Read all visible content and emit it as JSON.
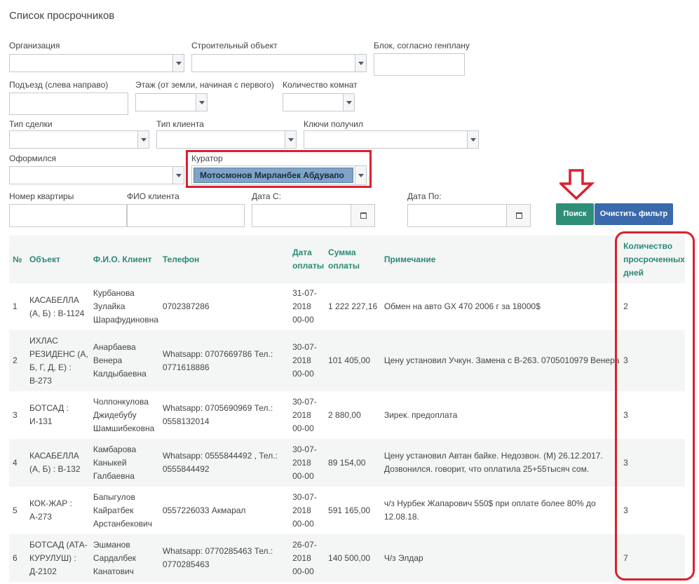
{
  "page": {
    "title": "Список просрочников"
  },
  "filters": {
    "organization": "Организация",
    "construction_object": "Строительный объект",
    "block": "Блок, согласно генплану",
    "entrance": "Подъезд (слева направо)",
    "floor": "Этаж (от земли, начиная с первого)",
    "rooms": "Количество комнат",
    "deal_type": "Тип сделки",
    "client_type": "Тип клиента",
    "keys_received": "Ключи получил",
    "registered": "Оформился",
    "curator": "Куратор",
    "curator_value": "Мотосмонов Мирланбек Абдувапо",
    "apartment_no": "Номер квартиры",
    "client_name": "ФИО клиента",
    "date_from": "Дата С:",
    "date_to": "Дата По:"
  },
  "buttons": {
    "search": "Поиск",
    "clear": "Очистить фильтр"
  },
  "table": {
    "headers": {
      "no": "№",
      "object": "Объект",
      "client": "Ф.И.О. Клиент",
      "phone": "Телефон",
      "pay_date": "Дата оплаты",
      "amount": "Сумма оплаты",
      "note": "Примечание",
      "overdue": "Количество просроченных дней"
    },
    "rows": [
      {
        "no": "1",
        "object": "КАСАБЕЛЛА (А, Б) : В-1124",
        "client": "Курбанова Зулайка Шарафудиновна",
        "phone": "0702387286",
        "date": "31-07-2018 00-00",
        "amount": "1 222 227,16",
        "note": "Обмен на авто GX 470 2006 г за 18000$",
        "days": "2"
      },
      {
        "no": "2",
        "object": "ИХЛАС РЕЗИДЕНС (А, Б, Г, Д, Е) : В-273",
        "client": "Анарбаева Венера Калдыбаевна",
        "phone": "Whatsapp: 0707669786 Тел.: 0771618886",
        "date": "30-07-2018 00-00",
        "amount": "101 405,00",
        "note": "Цену установил Учкун. Замена с В-263. 0705010979 Венера",
        "days": "3"
      },
      {
        "no": "3",
        "object": "БОТСАД : И-131",
        "client": "Чолпонкулова Джидебубу Шамшибековна",
        "phone": "Whatsapp: 0705690969 Тел.: 0558132014",
        "date": "30-07-2018 00-00",
        "amount": "2 880,00",
        "note": "Зирек. предоплата",
        "days": "3"
      },
      {
        "no": "4",
        "object": "КАСАБЕЛЛА (А, Б) : В-132",
        "client": "Камбарова Каныкей Галбаевна",
        "phone": "Whatsapp: 0555844492 , Тел.: 0555844492",
        "date": "30-07-2018 00-00",
        "amount": "89 154,00",
        "note": "Цену установил Автан байке. Недозвон. (М) 26.12.2017. Дозвонился. говорит, что оплатила 25+55тысяч сом.",
        "days": "3"
      },
      {
        "no": "5",
        "object": "КОК-ЖАР : А-273",
        "client": "Бапыгулов Кайратбек Арстанбекович",
        "phone": "0557226033 Акмарал",
        "date": "30-07-2018 00-00",
        "amount": "591 165,00",
        "note": "ч/з Нурбек Жапарович 550$ при оплате более 80% до 12.08.18.",
        "days": "3"
      },
      {
        "no": "6",
        "object": "БОТСАД (АТА-КУРУЛУШ) : Д-2102",
        "client": "Эшманов Сардалбек Канатович",
        "phone": "Whatsapp: 0770285463 Тел.: 0770285463",
        "date": "26-07-2018 00-00",
        "amount": "140 500,00",
        "note": "Ч/з Элдар",
        "days": "7"
      }
    ]
  }
}
